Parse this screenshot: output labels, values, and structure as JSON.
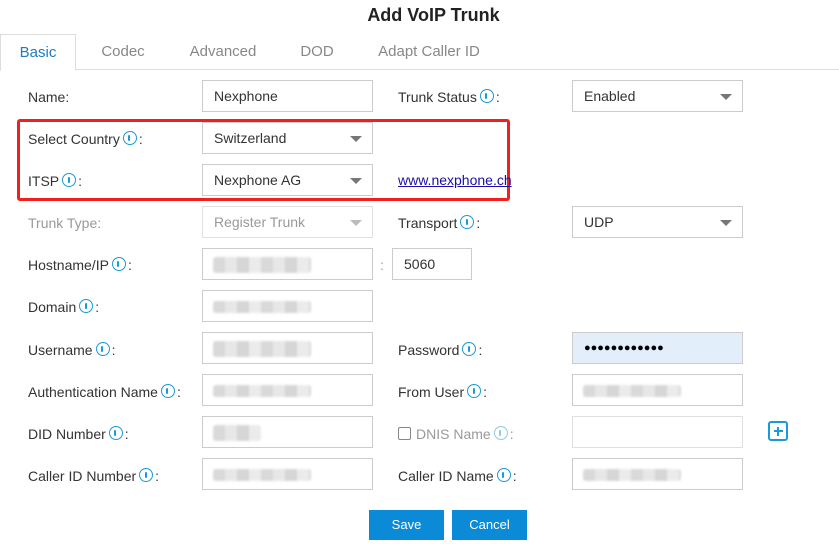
{
  "dialog": {
    "title": "Add VoIP Trunk"
  },
  "tabs": [
    {
      "label": "Basic",
      "active": true
    },
    {
      "label": "Codec",
      "active": false
    },
    {
      "label": "Advanced",
      "active": false
    },
    {
      "label": "DOD",
      "active": false
    },
    {
      "label": "Adapt Caller ID",
      "active": false
    }
  ],
  "form": {
    "name": {
      "label": "Name:",
      "value": "Nexphone"
    },
    "trunk_status": {
      "label": "Trunk Status",
      "value": "Enabled"
    },
    "select_country": {
      "label": "Select Country",
      "value": "Switzerland"
    },
    "itsp": {
      "label": "ITSP",
      "value": "Nexphone AG",
      "link": "www.nexphone.ch"
    },
    "trunk_type": {
      "label": "Trunk Type:",
      "value": "Register Trunk",
      "disabled": true
    },
    "transport": {
      "label": "Transport",
      "value": "UDP"
    },
    "hostname": {
      "label": "Hostname/IP",
      "value": "[redacted]",
      "port_separator": ":",
      "port": "5060"
    },
    "domain": {
      "label": "Domain",
      "value": "[redacted]"
    },
    "username": {
      "label": "Username",
      "value": "[redacted]"
    },
    "password": {
      "label": "Password",
      "value": "●●●●●●●●●●●●"
    },
    "auth_name": {
      "label": "Authentication Name",
      "value": "[redacted]"
    },
    "from_user": {
      "label": "From User",
      "value": "[redacted]"
    },
    "did_number": {
      "label": "DID Number",
      "value": "[redacted]"
    },
    "dnis_name": {
      "label": "DNIS Name",
      "value": "",
      "checked": false
    },
    "caller_id_number": {
      "label": "Caller ID Number",
      "value": "[redacted]"
    },
    "caller_id_name": {
      "label": "Caller ID Name",
      "value": "[redacted]"
    }
  },
  "colon": ":",
  "buttons": {
    "save": "Save",
    "cancel": "Cancel"
  },
  "colors": {
    "accent": "#0b8ad8",
    "highlight_border": "#f21f1f",
    "info_icon": "#1a9ad6",
    "link": "#1a0dab"
  }
}
